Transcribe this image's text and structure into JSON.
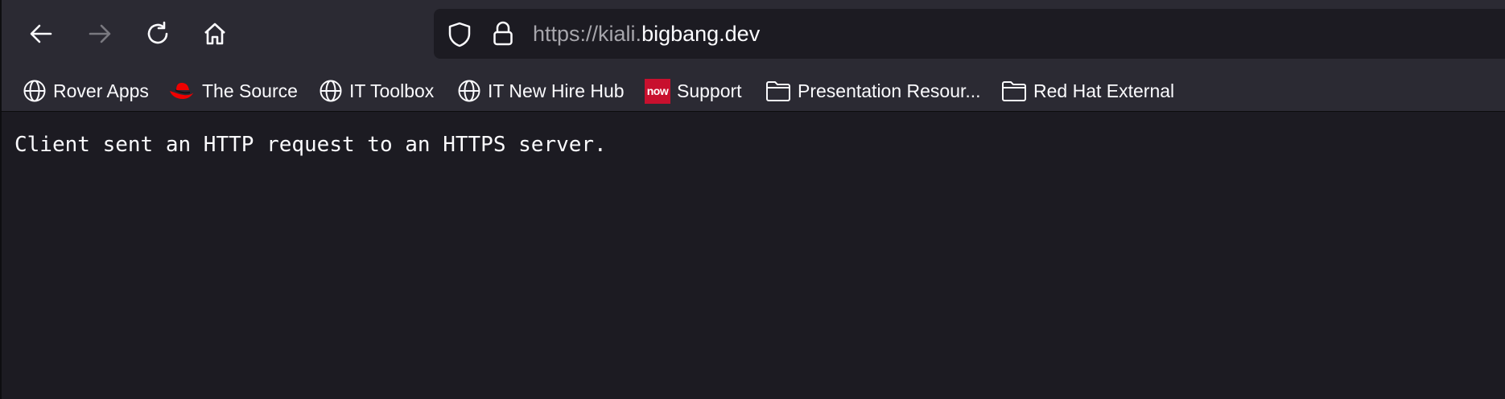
{
  "toolbar": {
    "back_icon": "arrow-left-icon",
    "forward_icon": "arrow-right-icon",
    "reload_icon": "reload-icon",
    "home_icon": "home-icon"
  },
  "urlbar": {
    "url_prefix": "https://kiali.",
    "url_domain": "bigbang.dev",
    "shield_icon": "shield-icon",
    "lock_icon": "lock-icon"
  },
  "bookmarks": [
    {
      "label": "Rover Apps",
      "icon": "globe-icon"
    },
    {
      "label": "The Source",
      "icon": "redhat-fedora-icon"
    },
    {
      "label": "IT Toolbox",
      "icon": "globe-icon"
    },
    {
      "label": "IT New Hire Hub",
      "icon": "globe-icon"
    },
    {
      "label": "Support",
      "icon": "servicenow-icon",
      "icon_text": "now"
    },
    {
      "label": "Presentation Resour...",
      "icon": "folder-icon"
    },
    {
      "label": "Red Hat External",
      "icon": "folder-icon"
    }
  ],
  "page": {
    "message": "Client sent an HTTP request to an HTTPS server."
  },
  "colors": {
    "chrome_bg": "#2b2a33",
    "page_bg": "#1c1b22",
    "text": "#fbfbfe",
    "url_dim": "#a6a5ab",
    "redhat_red": "#ee0000"
  }
}
